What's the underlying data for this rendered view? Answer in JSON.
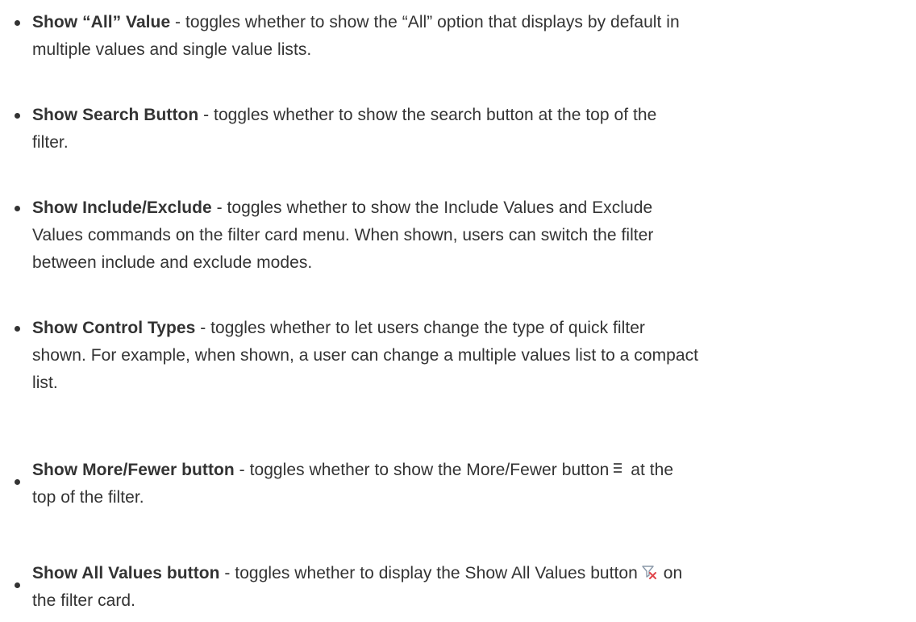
{
  "items": [
    {
      "term": "Show “All” Value",
      "line1": " - toggles whether to show the “All” option that displays by default in",
      "line2": "multiple values and single value lists."
    },
    {
      "term": "Show Search Button",
      "line1": " - toggles whether to show the search button at the top of the",
      "line2": "filter."
    },
    {
      "term": "Show Include/Exclude",
      "line1": " - toggles whether to show the Include Values and Exclude",
      "line2": "Values commands on the filter card menu. When shown, users can switch the filter",
      "line3": "between include and exclude modes."
    },
    {
      "term": "Show Control Types",
      "line1": " - toggles whether to let users change the type of quick filter",
      "line2": "shown. For example, when shown, a user can change a multiple values list to a compact",
      "line3": "list."
    },
    {
      "term": "Show More/Fewer button",
      "line1_before": " - toggles whether to show the More/Fewer button",
      "icon": "more-fewer-icon",
      "line1_after": " at the",
      "line2": "top of the filter."
    },
    {
      "term": "Show All Values button",
      "line1_before": " - toggles whether to display the Show All Values button",
      "icon": "show-all-values-icon",
      "line1_after": " on",
      "line2": "the filter card."
    }
  ],
  "colors": {
    "text": "#333333",
    "icon_gray": "#8a98a8",
    "icon_red": "#e0474c"
  }
}
